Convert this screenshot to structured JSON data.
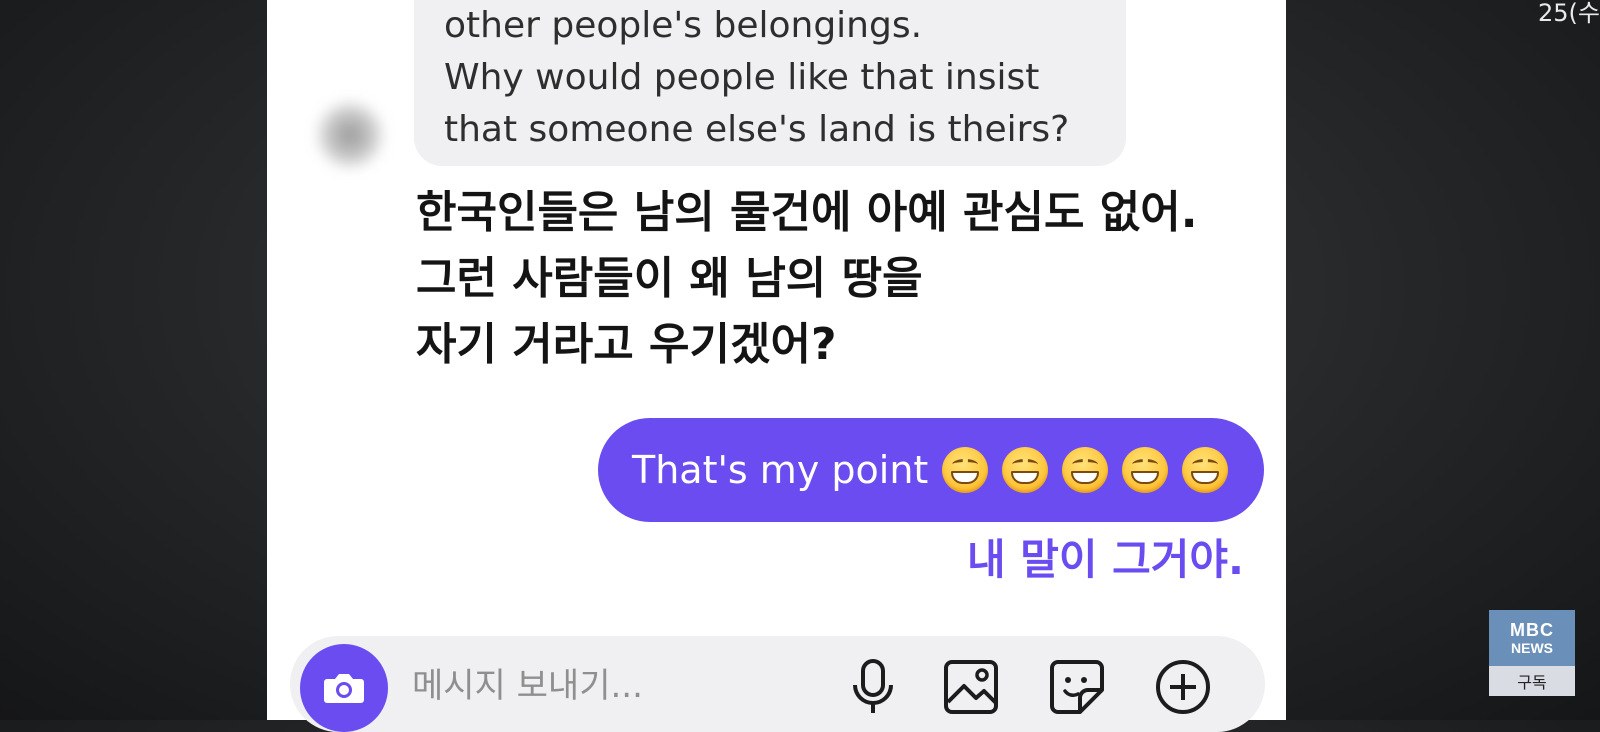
{
  "overlay": {
    "timer_text": "25(수"
  },
  "chat": {
    "incoming_message": {
      "lines": [
        "other people's belongings.",
        "Why would people like that insist",
        "that someone else's land is theirs?"
      ]
    },
    "incoming_translation": {
      "lines": [
        "한국인들은 남의 물건에 아예 관심도 없어.",
        "그런 사람들이 왜 남의 땅을",
        "자기 거라고 우기겠어?"
      ]
    },
    "outgoing_message": {
      "text": "That's my point",
      "emoji_count": 5,
      "emoji_name": "grinning-face-with-smiling-eyes"
    },
    "outgoing_translation": "내 말이 그거야."
  },
  "composer": {
    "placeholder": "메시지 보내기...",
    "buttons": {
      "camera": "camera-icon",
      "voice": "microphone-icon",
      "gallery": "image-icon",
      "sticker": "sticker-icon",
      "more": "plus-circle-icon"
    }
  },
  "broadcaster_badge": {
    "logo_text": "MBC",
    "news_text": "NEWS",
    "subscribe_label": "구독"
  },
  "colors": {
    "accent": "#6a4cf0",
    "incoming_bubble": "#f0f0f2",
    "badge": "#6a8fb8"
  }
}
